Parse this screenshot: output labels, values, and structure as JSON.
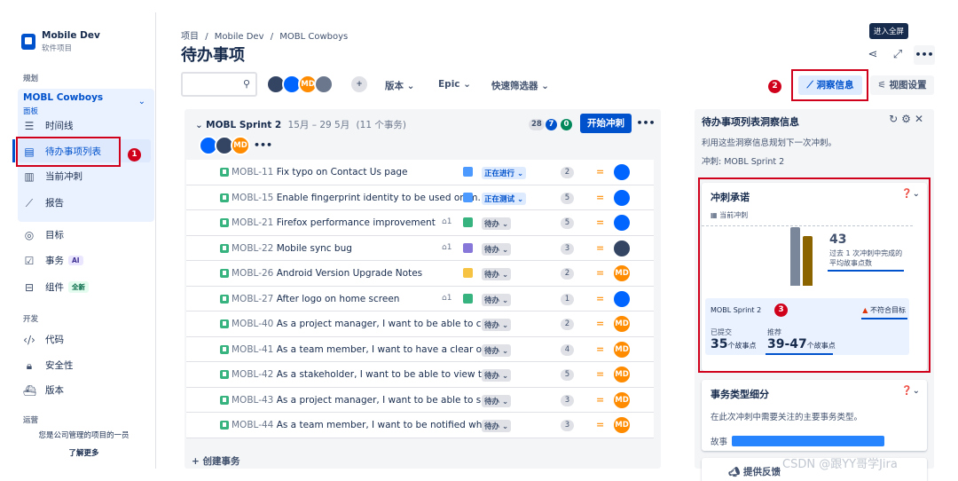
{
  "project": {
    "name": "Mobile Dev",
    "type": "软件项目"
  },
  "sidebar": {
    "planning_label": "规划",
    "board": {
      "name": "MOBL Cowboys",
      "sub": "面板"
    },
    "items": [
      {
        "label": "时间线",
        "icon": "timeline-icon"
      },
      {
        "label": "待办事项列表",
        "icon": "backlog-icon"
      },
      {
        "label": "当前冲刺",
        "icon": "board-icon"
      },
      {
        "label": "报告",
        "icon": "reports-icon"
      },
      {
        "label": "目标",
        "icon": "goals-icon"
      },
      {
        "label": "事务",
        "icon": "issues-icon",
        "tag": "AI"
      },
      {
        "label": "组件",
        "icon": "components-icon",
        "tag": "全新"
      }
    ],
    "dev_label": "开发",
    "dev_items": [
      {
        "label": "代码",
        "icon": "code-icon"
      },
      {
        "label": "安全性",
        "icon": "lock-icon"
      },
      {
        "label": "版本",
        "icon": "releases-icon"
      }
    ],
    "ops_label": "运营",
    "footer_text": "您是公司管理的项目的一员",
    "learn_more": "了解更多"
  },
  "annotations": {
    "one": "1",
    "two": "2",
    "three": "3"
  },
  "header": {
    "breadcrumb": [
      "项目",
      "Mobile Dev",
      "MOBL Cowboys"
    ],
    "breadcrumb_sep": "/",
    "title": "待办事项",
    "tooltip": "进入全屏"
  },
  "toolbar": {
    "filters": [
      "版本",
      "Epic",
      "快速筛选器"
    ],
    "insights_label": "洞察信息",
    "view_settings_label": "视图设置",
    "avatar_initials": "MD"
  },
  "sprint": {
    "name": "MOBL Sprint 2",
    "dates": "15月 – 29 5月",
    "count": "(11 个事务)",
    "counts": [
      "28",
      "7",
      "0"
    ],
    "start_label": "开始冲刺",
    "assignee_initials": "MD",
    "more": "•••"
  },
  "issues": [
    {
      "key": "MOBL-11",
      "summary": "Fix typo on Contact Us page",
      "child": "",
      "epic": "#4c9aff",
      "status": "正在进行",
      "status_color": "blue",
      "points": "2",
      "assignee": "blue",
      "initials": ""
    },
    {
      "key": "MOBL-15",
      "summary": "Enable fingerprint identity to be used on m...",
      "child": "",
      "epic": "#4c9aff",
      "status": "正在测试",
      "status_color": "blue",
      "points": "5",
      "assignee": "blue",
      "initials": ""
    },
    {
      "key": "MOBL-21",
      "summary": "Firefox performance improvement",
      "child": "1",
      "epic": "#36b37e",
      "status": "待办",
      "status_color": "gray",
      "points": "5",
      "assignee": "blue",
      "initials": ""
    },
    {
      "key": "MOBL-22",
      "summary": "Mobile sync bug",
      "child": "1",
      "epic": "#8777d9",
      "status": "待办",
      "status_color": "gray",
      "points": "3",
      "assignee": "dark",
      "initials": ""
    },
    {
      "key": "MOBL-26",
      "summary": "Android Version Upgrade Notes",
      "child": "",
      "epic": "#f6c342",
      "status": "待办",
      "status_color": "gray",
      "points": "2",
      "assignee": "orange",
      "initials": "MD"
    },
    {
      "key": "MOBL-27",
      "summary": "After logo on home screen",
      "child": "1",
      "epic": "#36b37e",
      "status": "待办",
      "status_color": "gray",
      "points": "1",
      "assignee": "blue",
      "initials": ""
    },
    {
      "key": "MOBL-40",
      "summary": "As a project manager, I want to be able to c...",
      "child": "",
      "epic": "",
      "status": "待办",
      "status_color": "gray",
      "points": "2",
      "assignee": "orange",
      "initials": "MD"
    },
    {
      "key": "MOBL-41",
      "summary": "As a team member, I want to have a clear o...",
      "child": "",
      "epic": "",
      "status": "待办",
      "status_color": "gray",
      "points": "4",
      "assignee": "orange",
      "initials": "MD"
    },
    {
      "key": "MOBL-42",
      "summary": "As a stakeholder, I want to be able to view t...",
      "child": "",
      "epic": "",
      "status": "待办",
      "status_color": "gray",
      "points": "5",
      "assignee": "orange",
      "initials": "MD"
    },
    {
      "key": "MOBL-43",
      "summary": "As a project manager, I want to be able to s...",
      "child": "",
      "epic": "",
      "status": "待办",
      "status_color": "gray",
      "points": "3",
      "assignee": "orange",
      "initials": "MD"
    },
    {
      "key": "MOBL-44",
      "summary": "As a team member, I want to be notified wh...",
      "child": "",
      "epic": "",
      "status": "待办",
      "status_color": "gray",
      "points": "3",
      "assignee": "orange",
      "initials": "MD"
    }
  ],
  "create_issue": "+ 创建事务",
  "insights": {
    "title": "待办事项列表洞察信息",
    "description": "利用这些洞察信息规划下一次冲刺。",
    "sprint_line": "冲刺: MOBL Sprint 2",
    "commitment": {
      "title": "冲刺承诺",
      "current_label": "当前冲刺",
      "avg_value": "43",
      "avg_note_1": "过去 1 次冲刺中完成的",
      "avg_note_2": "平均故事点数",
      "sprint_name": "MOBL Sprint 2",
      "warning": "不符合目标",
      "committed_label": "已提交",
      "committed_value": "35",
      "committed_unit": "个故事点",
      "recommended_label": "推荐",
      "recommended_value": "39-47",
      "recommended_unit": "个故事点"
    },
    "breakdown": {
      "title": "事务类型细分",
      "description": "在此次冲刺中需要关注的主要事务类型。",
      "type_label": "故事"
    },
    "feedback_label": "提供反馈"
  },
  "watermark": "CSDN @跟YY哥学Jira"
}
